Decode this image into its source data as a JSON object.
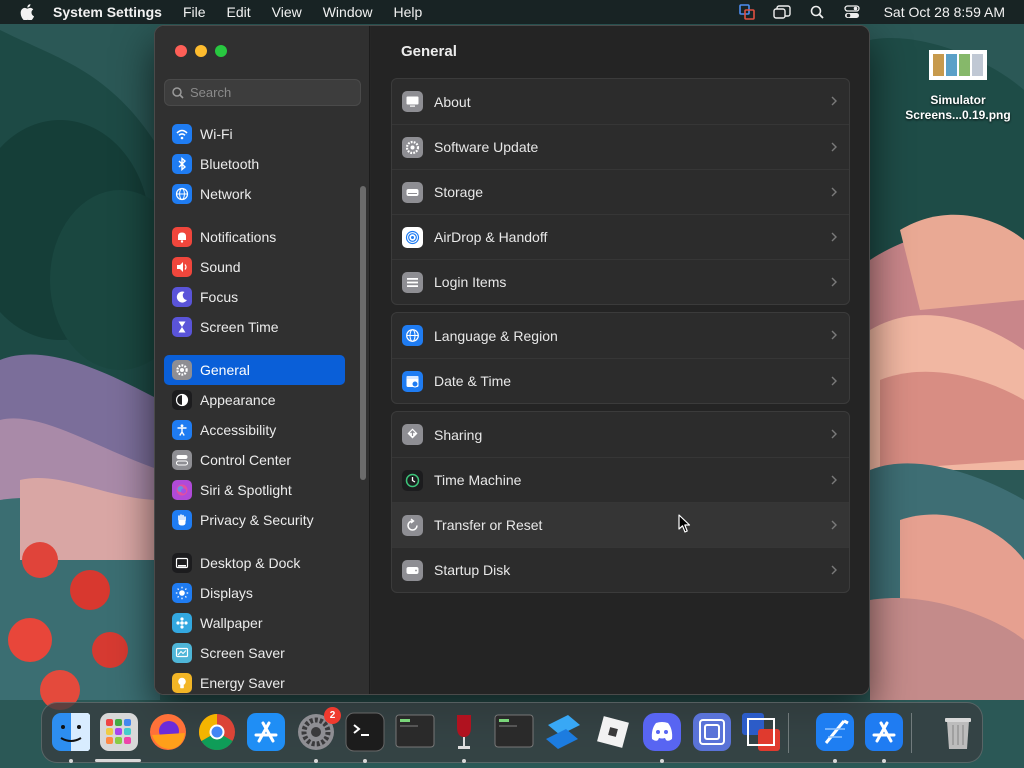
{
  "menubar": {
    "app_name": "System Settings",
    "menus": [
      "File",
      "Edit",
      "View",
      "Window",
      "Help"
    ],
    "clock": "Sat Oct 28  8:59 AM"
  },
  "desktop": {
    "file_label_line1": "Simulator",
    "file_label_line2": "Screens...0.19.png"
  },
  "sidebar": {
    "search_placeholder": "Search",
    "groups": [
      [
        {
          "label": "Wi-Fi",
          "icon": "wifi-icon",
          "color": "#1f7cf2"
        },
        {
          "label": "Bluetooth",
          "icon": "bluetooth-icon",
          "color": "#1f7cf2"
        },
        {
          "label": "Network",
          "icon": "network-globe-icon",
          "color": "#1f7cf2"
        }
      ],
      [
        {
          "label": "Notifications",
          "icon": "notifications-bell-icon",
          "color": "#f0463c"
        },
        {
          "label": "Sound",
          "icon": "speaker-icon",
          "color": "#f0463c"
        },
        {
          "label": "Focus",
          "icon": "moon-icon",
          "color": "#5a54d9"
        },
        {
          "label": "Screen Time",
          "icon": "hourglass-icon",
          "color": "#5a54d9"
        }
      ],
      [
        {
          "label": "General",
          "icon": "gear-icon",
          "color": "#8e8e93",
          "selected": true
        },
        {
          "label": "Appearance",
          "icon": "appearance-icon",
          "color": "#1c1c1e"
        },
        {
          "label": "Accessibility",
          "icon": "accessibility-icon",
          "color": "#1f7cf2"
        },
        {
          "label": "Control Center",
          "icon": "control-center-icon",
          "color": "#8e8e93"
        },
        {
          "label": "Siri & Spotlight",
          "icon": "siri-icon",
          "color": "#b04ad8"
        },
        {
          "label": "Privacy & Security",
          "icon": "hand-icon",
          "color": "#1f7cf2"
        }
      ],
      [
        {
          "label": "Desktop & Dock",
          "icon": "dock-icon",
          "color": "#1c1c1e"
        },
        {
          "label": "Displays",
          "icon": "sun-icon",
          "color": "#1f7cf2"
        },
        {
          "label": "Wallpaper",
          "icon": "wallpaper-icon",
          "color": "#33a8e0"
        },
        {
          "label": "Screen Saver",
          "icon": "screen-saver-icon",
          "color": "#4fb6d8"
        },
        {
          "label": "Energy Saver",
          "icon": "lightbulb-icon",
          "color": "#f2b526"
        }
      ]
    ]
  },
  "content": {
    "title": "General",
    "groups": [
      [
        {
          "label": "About",
          "icon": "about-icon",
          "color": "#8e8e93"
        },
        {
          "label": "Software Update",
          "icon": "software-update-icon",
          "color": "#8e8e93"
        },
        {
          "label": "Storage",
          "icon": "storage-icon",
          "color": "#8e8e93"
        },
        {
          "label": "AirDrop & Handoff",
          "icon": "airdrop-icon",
          "color": "#ffffff"
        },
        {
          "label": "Login Items",
          "icon": "login-items-icon",
          "color": "#8e8e93"
        }
      ],
      [
        {
          "label": "Language & Region",
          "icon": "language-globe-icon",
          "color": "#1f7cf2"
        },
        {
          "label": "Date & Time",
          "icon": "calendar-clock-icon",
          "color": "#1f7cf2"
        }
      ],
      [
        {
          "label": "Sharing",
          "icon": "sharing-icon",
          "color": "#8e8e93"
        },
        {
          "label": "Time Machine",
          "icon": "time-machine-icon",
          "color": "#1c1c1e"
        },
        {
          "label": "Transfer or Reset",
          "icon": "transfer-reset-icon",
          "color": "#8e8e93",
          "hover": true
        },
        {
          "label": "Startup Disk",
          "icon": "startup-disk-icon",
          "color": "#8e8e93"
        }
      ]
    ]
  },
  "dock": {
    "apps": [
      {
        "name": "finder-icon",
        "color": "#2d8ef0"
      },
      {
        "name": "launchpad-icon",
        "color": "#d8d8d8"
      },
      {
        "name": "firefox-icon",
        "color": "#ff7139"
      },
      {
        "name": "chrome-icon",
        "color": "#ffffff"
      },
      {
        "name": "app-store-icon",
        "color": "#1f8ef5"
      },
      {
        "name": "system-settings-icon",
        "color": "#8e8e93"
      },
      {
        "name": "terminal-icon",
        "color": "#1c1c1c"
      },
      {
        "name": "console-icon",
        "color": "#2a2a2a"
      },
      {
        "name": "wine-icon",
        "color": "#7a0d16"
      },
      {
        "name": "console-2-icon",
        "color": "#2a2a2a"
      },
      {
        "name": "blue-cube-app-icon",
        "color": "#1c8ef0"
      },
      {
        "name": "roblox-icon",
        "color": "#f2f2f2"
      },
      {
        "name": "discord-icon",
        "color": "#5865f2"
      },
      {
        "name": "virtual-machine-icon",
        "color": "#5a73d8"
      },
      {
        "name": "migration-icon",
        "color": "#2c5cc8"
      },
      {
        "name": "xcode-icon",
        "color": "#1e7ef2"
      },
      {
        "name": "simulator-icon",
        "color": "#1f7cf2"
      },
      {
        "name": "trash-icon",
        "color": "#9a9a9a"
      }
    ],
    "settings_badge": "2"
  }
}
